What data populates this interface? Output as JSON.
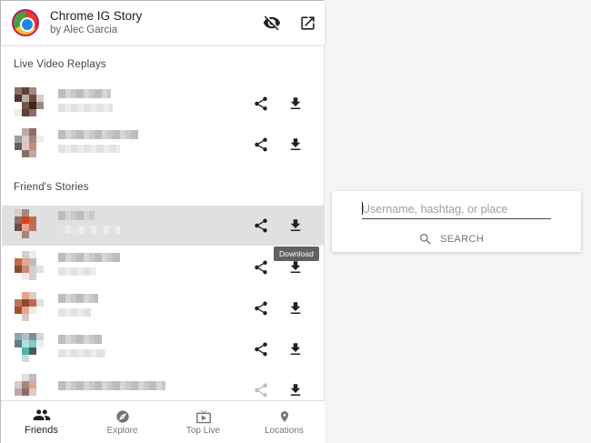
{
  "header": {
    "title": "Chrome IG Story",
    "author": "by Alec Garcia",
    "hide_icon": "eye-off-icon",
    "open_icon": "open-in-new-icon"
  },
  "sections": {
    "live": "Live Video Replays",
    "friends": "Friend's Stories"
  },
  "tooltip": "Download",
  "nav": {
    "items": [
      {
        "label": "Friends",
        "icon": "people-icon"
      },
      {
        "label": "Explore",
        "icon": "compass-icon"
      },
      {
        "label": "Top Live",
        "icon": "live-tv-icon"
      },
      {
        "label": "Locations",
        "icon": "location-pin-icon"
      }
    ],
    "selected": "Friends"
  },
  "search": {
    "placeholder": "Username, hashtag, or place",
    "button": "SEARCH"
  },
  "colors": {
    "accent": "#212121",
    "active_row": "#e0e0e0",
    "icon": "#212121",
    "icon_disabled": "#bdbdbd"
  }
}
